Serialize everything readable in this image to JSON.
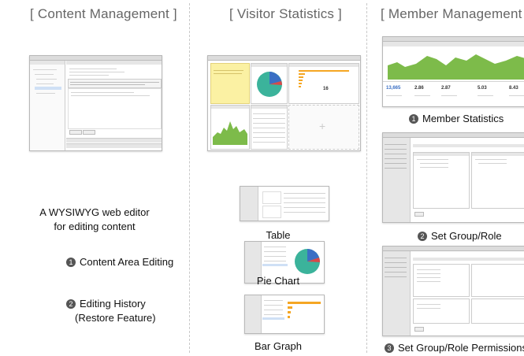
{
  "columns": {
    "content": {
      "title": "[ Content Management ]",
      "description_line1": "A WYSIWYG web editor",
      "description_line2": "for editing content",
      "features": [
        {
          "num": "1",
          "label": "Content Area Editing"
        },
        {
          "num": "2",
          "label_line1": "Editing History",
          "label_line2": "(Restore Feature)"
        }
      ]
    },
    "visitor": {
      "title": "[ Visitor Statistics ]",
      "mini_value": "16",
      "captions": [
        "Table",
        "Pie Chart",
        "Bar Graph"
      ]
    },
    "member": {
      "title": "[ Member Management ]",
      "stats": [
        "13,665",
        "2.86",
        "2.87",
        "5.03",
        "8.43"
      ],
      "captions": [
        {
          "num": "1",
          "label": "Member Statistics"
        },
        {
          "num": "2",
          "label": "Set Group/Role"
        },
        {
          "num": "3",
          "label": "Set Group/Role Permissions"
        }
      ]
    }
  },
  "colors": {
    "pie_teal": "#3bb39b",
    "pie_blue": "#3a6fc4",
    "pie_red": "#d94848",
    "area_green": "#7dbb4a",
    "sticky_yellow": "#fbf1a3",
    "bar_orange": "#f5a623",
    "bullet_gray": "#555555"
  }
}
